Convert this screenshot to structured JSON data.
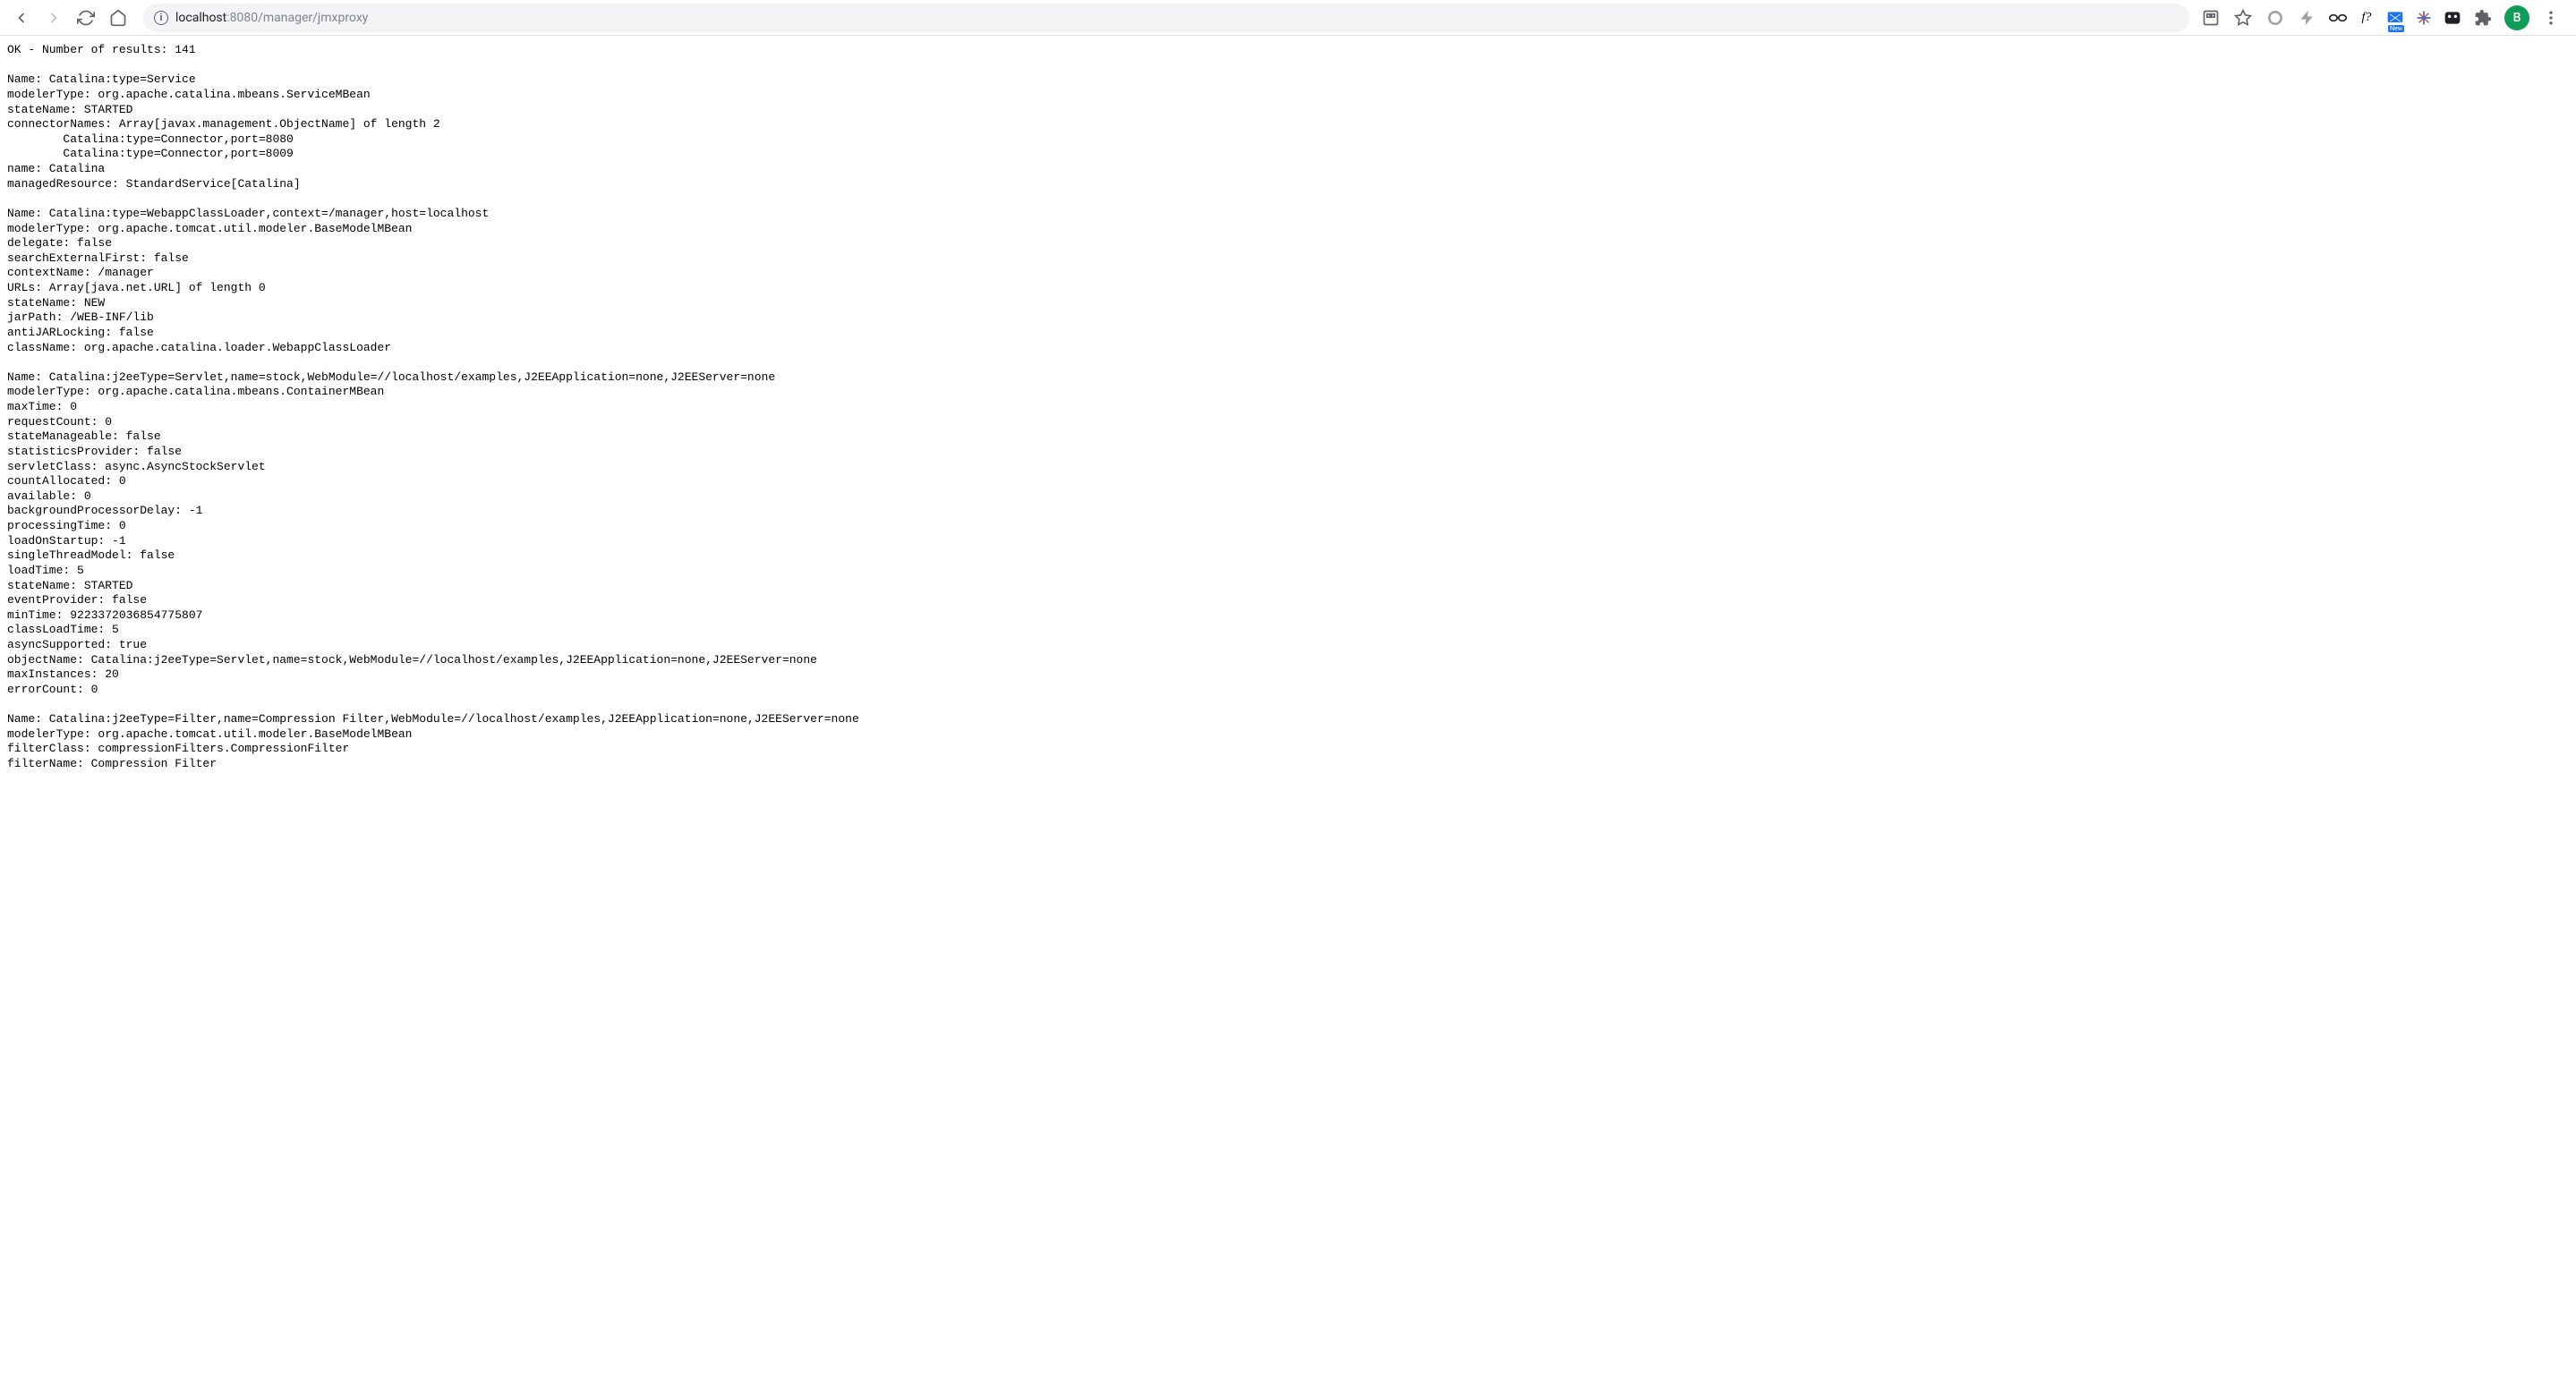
{
  "browser": {
    "url_host": "localhost",
    "url_port_path": ":8080/manager/jmxproxy",
    "avatar_letter": "B",
    "ext_new_label": "New",
    "function_label": "f?"
  },
  "page": {
    "status_line": "OK - Number of results: 141",
    "blocks": [
      {
        "lines": [
          "Name: Catalina:type=Service",
          "modelerType: org.apache.catalina.mbeans.ServiceMBean",
          "stateName: STARTED",
          "connectorNames: Array[javax.management.ObjectName] of length 2",
          "        Catalina:type=Connector,port=8080",
          "        Catalina:type=Connector,port=8009",
          "name: Catalina",
          "managedResource: StandardService[Catalina]"
        ]
      },
      {
        "lines": [
          "Name: Catalina:type=WebappClassLoader,context=/manager,host=localhost",
          "modelerType: org.apache.tomcat.util.modeler.BaseModelMBean",
          "delegate: false",
          "searchExternalFirst: false",
          "contextName: /manager",
          "URLs: Array[java.net.URL] of length 0",
          "stateName: NEW",
          "jarPath: /WEB-INF/lib",
          "antiJARLocking: false",
          "className: org.apache.catalina.loader.WebappClassLoader"
        ]
      },
      {
        "lines": [
          "Name: Catalina:j2eeType=Servlet,name=stock,WebModule=//localhost/examples,J2EEApplication=none,J2EEServer=none",
          "modelerType: org.apache.catalina.mbeans.ContainerMBean",
          "maxTime: 0",
          "requestCount: 0",
          "stateManageable: false",
          "statisticsProvider: false",
          "servletClass: async.AsyncStockServlet",
          "countAllocated: 0",
          "available: 0",
          "backgroundProcessorDelay: -1",
          "processingTime: 0",
          "loadOnStartup: -1",
          "singleThreadModel: false",
          "loadTime: 5",
          "stateName: STARTED",
          "eventProvider: false",
          "minTime: 9223372036854775807",
          "classLoadTime: 5",
          "asyncSupported: true",
          "objectName: Catalina:j2eeType=Servlet,name=stock,WebModule=//localhost/examples,J2EEApplication=none,J2EEServer=none",
          "maxInstances: 20",
          "errorCount: 0"
        ]
      },
      {
        "lines": [
          "Name: Catalina:j2eeType=Filter,name=Compression Filter,WebModule=//localhost/examples,J2EEApplication=none,J2EEServer=none",
          "modelerType: org.apache.tomcat.util.modeler.BaseModelMBean",
          "filterClass: compressionFilters.CompressionFilter",
          "filterName: Compression Filter"
        ]
      }
    ]
  }
}
